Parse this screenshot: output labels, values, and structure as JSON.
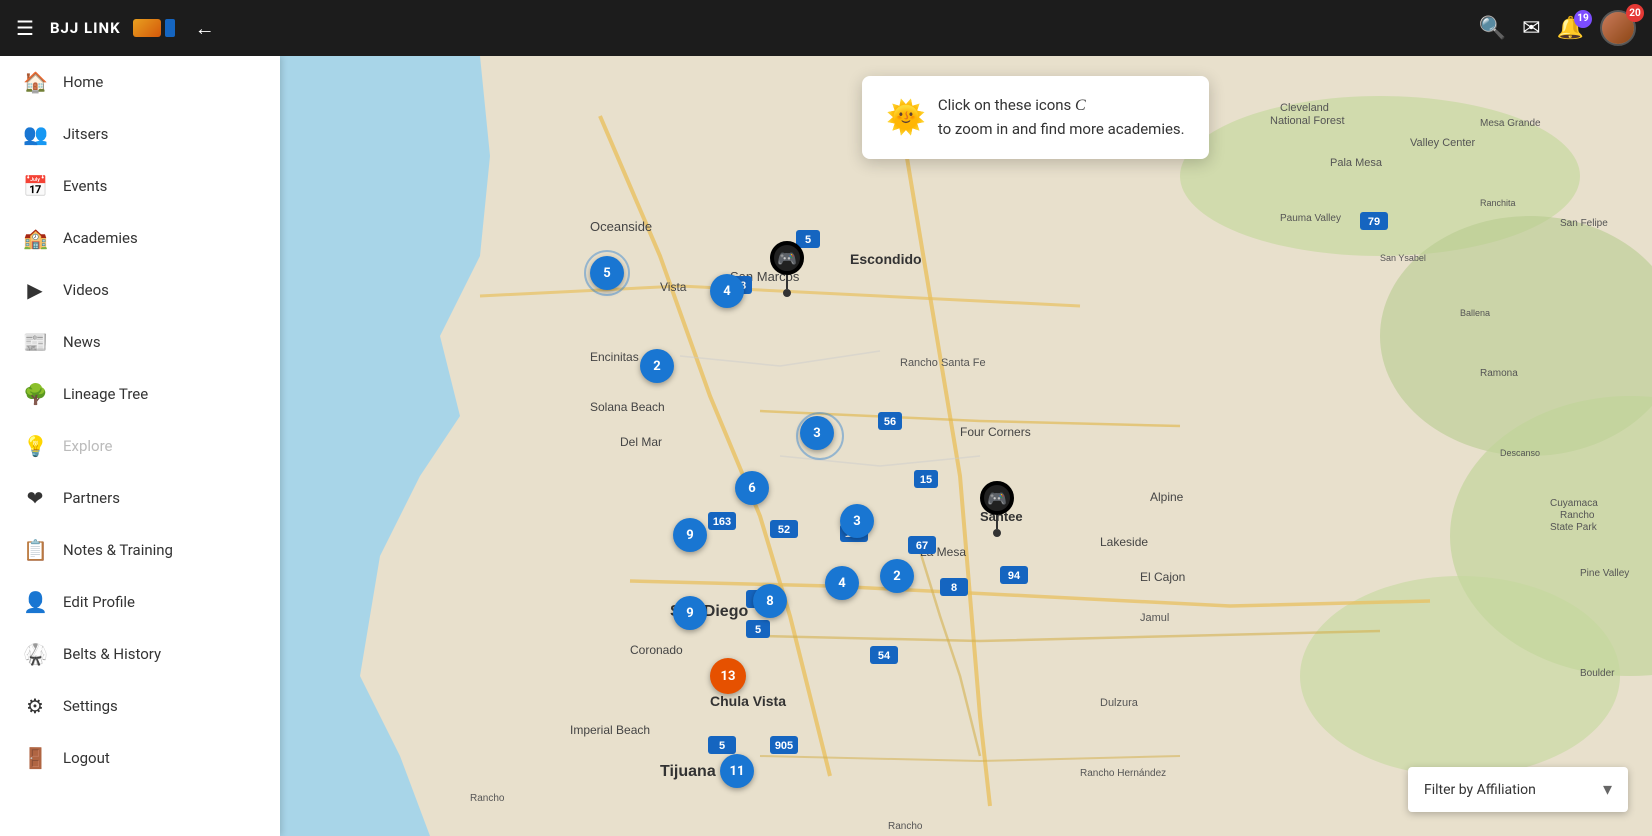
{
  "topbar": {
    "menu_icon": "☰",
    "logo": "BJJ LINK",
    "back_icon": "←",
    "search_icon": "🔍",
    "mail_icon": "✉",
    "bell_icon": "🔔",
    "notif_count_purple": "19",
    "notif_count_red": "20"
  },
  "sidebar": {
    "items": [
      {
        "id": "home",
        "label": "Home",
        "icon": "🏠",
        "active": false
      },
      {
        "id": "jitsers",
        "label": "Jitsers",
        "icon": "👥",
        "active": false
      },
      {
        "id": "events",
        "label": "Events",
        "icon": "📅",
        "active": false
      },
      {
        "id": "academies",
        "label": "Academies",
        "icon": "🏫",
        "active": false
      },
      {
        "id": "videos",
        "label": "Videos",
        "icon": "▶",
        "active": false
      },
      {
        "id": "news",
        "label": "News",
        "icon": "📰",
        "active": false
      },
      {
        "id": "lineage-tree",
        "label": "Lineage Tree",
        "icon": "🌳",
        "active": false
      },
      {
        "id": "explore",
        "label": "Explore",
        "icon": "💡",
        "active": false,
        "disabled": true
      },
      {
        "id": "partners",
        "label": "Partners",
        "icon": "❤",
        "active": false
      },
      {
        "id": "notes-training",
        "label": "Notes & Training",
        "icon": "📋",
        "active": false
      },
      {
        "id": "edit-profile",
        "label": "Edit Profile",
        "icon": "👤",
        "active": false
      },
      {
        "id": "belts-history",
        "label": "Belts & History",
        "icon": "🥋",
        "active": false
      },
      {
        "id": "settings",
        "label": "Settings",
        "icon": "⚙",
        "active": false
      },
      {
        "id": "logout",
        "label": "Logout",
        "icon": "🚪",
        "active": false
      }
    ]
  },
  "map": {
    "tooltip": {
      "text": "Click on these icons",
      "subtext": "to zoom in and find more academies."
    },
    "filter_label": "Filter by Affiliation",
    "clusters": [
      {
        "id": "c1",
        "count": "5",
        "top": "200",
        "left": "310",
        "size": "blue",
        "ripple": true
      },
      {
        "id": "c2",
        "count": "4",
        "top": "218",
        "left": "430",
        "size": "blue",
        "ripple": false
      },
      {
        "id": "c3",
        "count": "2",
        "top": "293",
        "left": "360",
        "size": "blue",
        "ripple": false
      },
      {
        "id": "c4",
        "count": "3",
        "top": "360",
        "left": "520",
        "size": "blue",
        "ripple": true
      },
      {
        "id": "c5",
        "count": "6",
        "top": "415",
        "left": "455",
        "size": "blue",
        "ripple": false
      },
      {
        "id": "c6",
        "count": "9",
        "top": "462",
        "left": "393",
        "size": "blue",
        "ripple": false
      },
      {
        "id": "c7",
        "count": "3",
        "top": "448",
        "left": "560",
        "size": "blue",
        "ripple": false
      },
      {
        "id": "c8",
        "count": "4",
        "top": "510",
        "left": "543",
        "size": "blue",
        "ripple": false
      },
      {
        "id": "c9",
        "count": "2",
        "top": "503",
        "left": "600",
        "size": "blue",
        "ripple": false
      },
      {
        "id": "c10",
        "count": "8",
        "top": "528",
        "left": "473",
        "size": "blue",
        "ripple": false
      },
      {
        "id": "c11",
        "count": "9",
        "top": "540",
        "left": "393",
        "size": "blue",
        "ripple": false
      },
      {
        "id": "c12",
        "count": "13",
        "top": "602",
        "left": "433",
        "size": "orange",
        "ripple": false
      },
      {
        "id": "c13",
        "count": "11",
        "top": "698",
        "left": "440",
        "size": "blue",
        "ripple": false
      }
    ],
    "pins": [
      {
        "id": "p1",
        "top": "195",
        "left": "485"
      },
      {
        "id": "p2",
        "top": "435",
        "left": "695"
      }
    ]
  }
}
